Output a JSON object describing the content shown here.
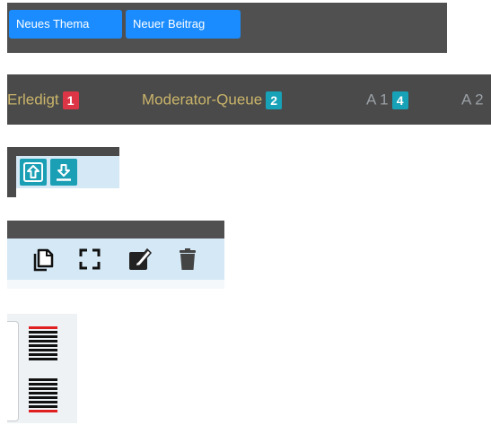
{
  "toolbar": {
    "new_topic_label": "Neues Thema",
    "new_post_label": "Neuer Beitrag",
    "button_color": "#1a8cff"
  },
  "queue_tabs": [
    {
      "label": "Erledigt",
      "count": "1",
      "badge_color": "#dc3545",
      "text_color": "#c9b46a"
    },
    {
      "label": "Moderator-Queue",
      "count": "2",
      "badge_color": "#17a2b8",
      "text_color": "#c9b46a"
    },
    {
      "label": "A 1",
      "count": "4",
      "badge_color": "#17a2b8",
      "text_color": "#9aa0a6"
    },
    {
      "label": "A 2",
      "count": "",
      "badge_color": "",
      "text_color": "#9aa0a6"
    }
  ],
  "move_tools": {
    "icons": [
      "arrow-up-box-icon",
      "arrow-down-box-icon"
    ],
    "accent": "#1a9fb5"
  },
  "edit_tools": {
    "icons": [
      "copy-icon",
      "expand-icon",
      "edit-icon",
      "trash-icon"
    ]
  },
  "drag_handles": {
    "icons": [
      "drag-handle-top-icon",
      "drag-handle-bottom-icon"
    ],
    "accent": "#e02020"
  }
}
